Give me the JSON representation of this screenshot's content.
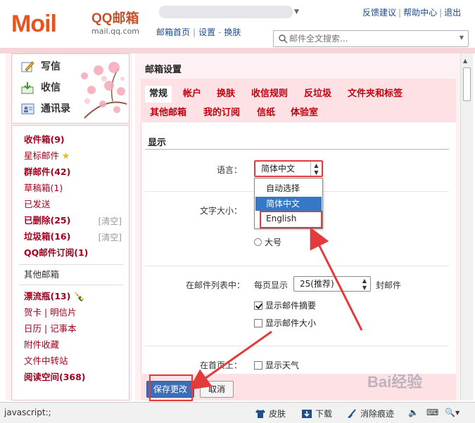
{
  "header": {
    "logo_mark": "Moil",
    "logo_name": "QQ邮箱",
    "logo_url": "mail.qq.com",
    "top_links": [
      "反馈建议",
      "帮助中心",
      "退出"
    ],
    "nav_links": [
      "邮箱首页",
      "设置",
      "换肤"
    ],
    "search_placeholder": "邮件全文搜索..."
  },
  "left": {
    "actions": [
      {
        "label": "写信",
        "icon": "pencil-icon"
      },
      {
        "label": "收信",
        "icon": "inbox-download-icon"
      },
      {
        "label": "通讯录",
        "icon": "contacts-icon"
      }
    ],
    "folders": [
      {
        "label": "收件箱(9)",
        "style": "bold"
      },
      {
        "label": "星标邮件",
        "style": "normal",
        "icon": "star-icon"
      },
      {
        "label": "群邮件(42)",
        "style": "bold"
      },
      {
        "label": "草稿箱(1)",
        "style": "normal"
      },
      {
        "label": "已发送",
        "style": "normal"
      },
      {
        "label": "已删除(25)",
        "style": "bold",
        "clear": "[清空]"
      },
      {
        "label": "垃圾箱(16)",
        "style": "bold",
        "clear": "[清空]"
      },
      {
        "label": "QQ邮件订阅(1)",
        "style": "bold"
      }
    ],
    "other": "其他邮箱",
    "folders2": [
      {
        "label": "漂流瓶(13)",
        "style": "bold",
        "icon": "bottle-icon"
      },
      {
        "label": "贺卡 | 明信片",
        "style": "normal"
      },
      {
        "label": "日历 | 记事本",
        "style": "normal"
      },
      {
        "label": "附件收藏",
        "style": "normal"
      },
      {
        "label": "文件中转站",
        "style": "normal"
      },
      {
        "label": "阅读空间(368)",
        "style": "bold"
      }
    ]
  },
  "main": {
    "title": "邮箱设置",
    "tabs_row1": [
      "常规",
      "帐户",
      "换肤",
      "收信规则",
      "反垃圾",
      "文件夹和标签"
    ],
    "tabs_row2": [
      "其他邮箱",
      "我的订阅",
      "信纸",
      "体验室"
    ],
    "active_tab": "常规",
    "section_display": "显示",
    "language": {
      "label": "语言：",
      "value": "简体中文",
      "options": [
        "自动选择",
        "简体中文",
        "English"
      ],
      "highlighted": "简体中文"
    },
    "font_size": {
      "label": "文字大小：",
      "option_large": "大号"
    },
    "list": {
      "label": "在邮件列表中：",
      "per_page_label": "每页显示",
      "per_page_value": "25(推荐)",
      "per_page_suffix": "封邮件",
      "show_summary": "显示邮件摘要",
      "show_summary_checked": true,
      "show_size": "显示邮件大小",
      "show_size_checked": false
    },
    "homepage": {
      "label": "在首页上：",
      "show_weather": "显示天气"
    },
    "buttons": {
      "save": "保存更改",
      "cancel": "取消"
    }
  },
  "statusbar": {
    "text": "javascript:;",
    "items": [
      "皮肤",
      "下载",
      "消除痕迹"
    ]
  },
  "watermark": "Bai经验",
  "colors": {
    "accent_red": "#c3000e",
    "link_blue": "#1a4b8c",
    "pink": "#fde1e4",
    "annotation": "#e23b3b",
    "button_blue": "#3b6eb8"
  }
}
